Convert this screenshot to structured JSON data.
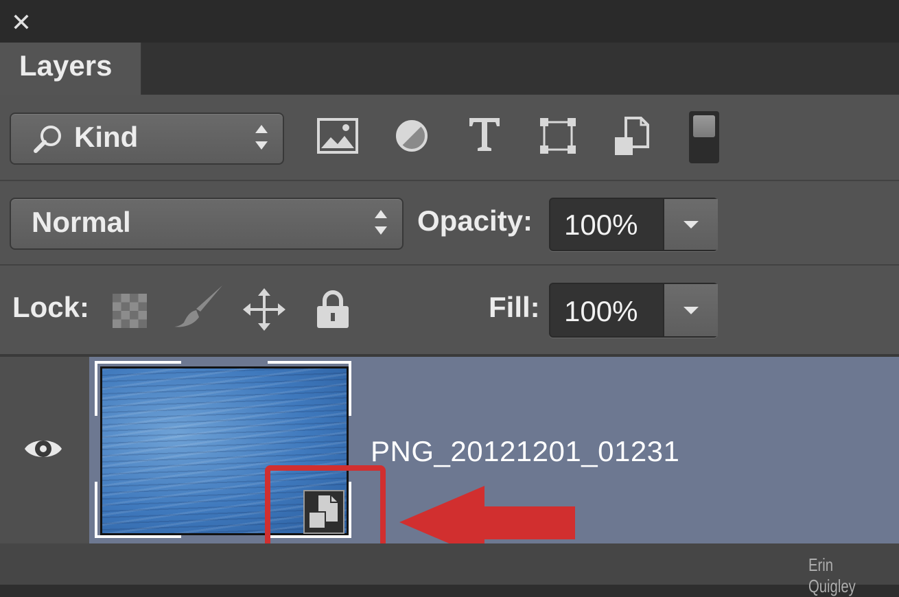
{
  "window": {
    "close_glyph": "✕"
  },
  "tabs": [
    {
      "label": "Layers",
      "active": true
    }
  ],
  "filter": {
    "kind_label": "Kind",
    "icons": [
      "search-icon",
      "image-filter-icon",
      "adjustment-filter-icon",
      "type-filter-icon",
      "shape-filter-icon",
      "smart-object-filter-icon",
      "filter-toggle-switch"
    ]
  },
  "blend": {
    "mode": "Normal",
    "opacity_label": "Opacity:",
    "opacity_value": "100%"
  },
  "lock": {
    "label": "Lock:",
    "icons": [
      "lock-transparent-pixels-icon",
      "lock-image-pixels-icon",
      "lock-position-icon",
      "lock-all-icon"
    ],
    "fill_label": "Fill:",
    "fill_value": "100%"
  },
  "layers": [
    {
      "name": "PNG_20121201_01231",
      "visible": true,
      "smart_object": true,
      "selected": true
    }
  ],
  "annotation": {
    "color": "#d12f2f",
    "arrow_target": "smart-object-badge-icon"
  },
  "watermark": "Erin Quigley"
}
